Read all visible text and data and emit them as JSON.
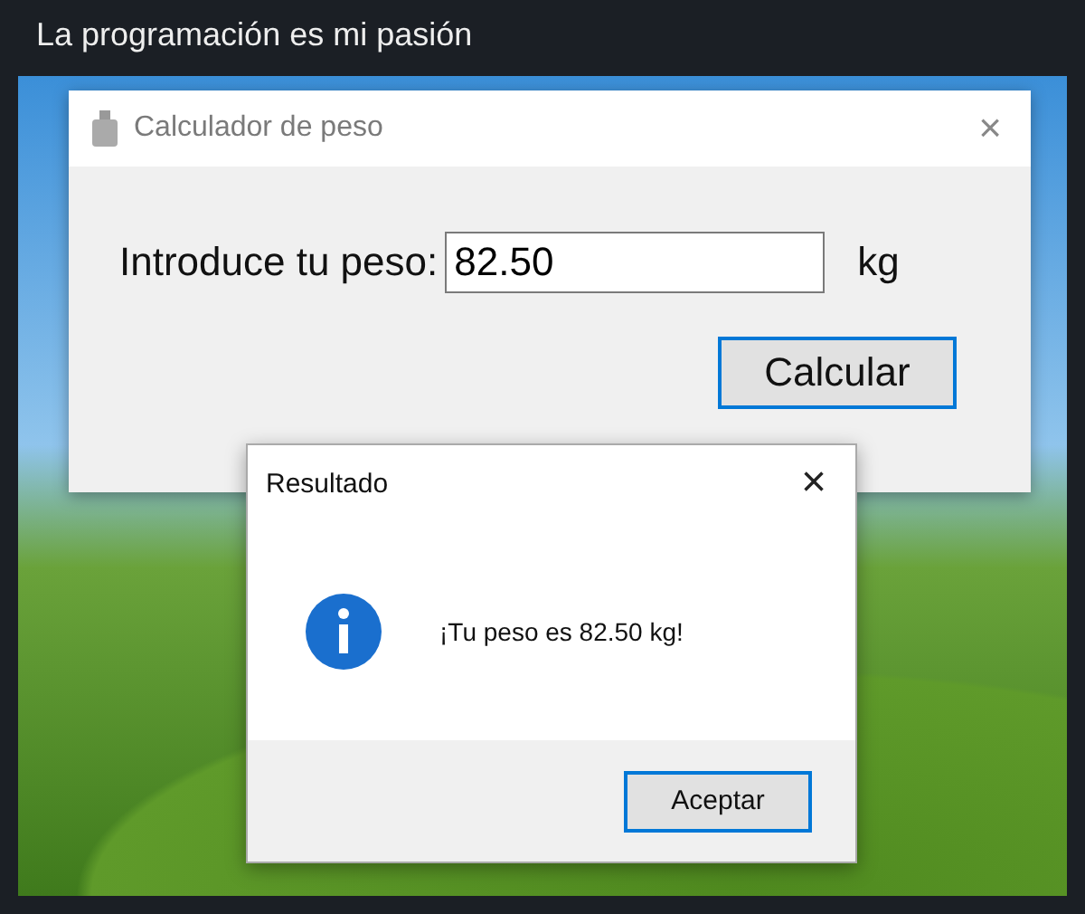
{
  "post": {
    "title": "La programación es mi pasión"
  },
  "main_window": {
    "title": "Calculador de peso",
    "close": "×",
    "label": "Introduce tu peso:",
    "value": "82.50",
    "unit": "kg",
    "button": "Calcular"
  },
  "dialog": {
    "title": "Resultado",
    "close": "×",
    "message": "¡Tu peso es 82.50 kg!",
    "button": "Aceptar"
  }
}
